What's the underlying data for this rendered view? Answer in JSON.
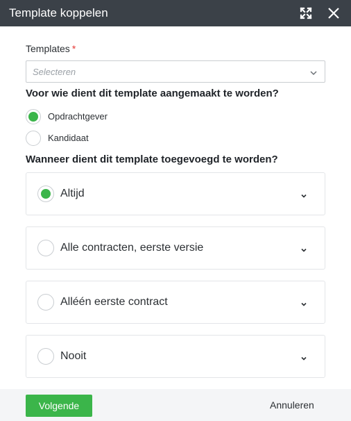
{
  "dialog": {
    "title": "Template koppelen"
  },
  "templates_field": {
    "label": "Templates",
    "required_marker": "*",
    "placeholder": "Selecteren"
  },
  "question_1": {
    "text": "Voor wie dient dit template aangemaakt te worden?",
    "options": [
      {
        "label": "Opdrachtgever",
        "selected": true
      },
      {
        "label": "Kandidaat",
        "selected": false
      }
    ]
  },
  "question_2": {
    "text": "Wanneer dient dit template toegevoegd te worden?",
    "options": [
      {
        "label": "Altijd",
        "selected": true
      },
      {
        "label": "Alle contracten, eerste versie",
        "selected": false
      },
      {
        "label": "Alléén eerste contract",
        "selected": false
      },
      {
        "label": "Nooit",
        "selected": false
      }
    ]
  },
  "footer": {
    "next_label": "Volgende",
    "cancel_label": "Annuleren"
  },
  "colors": {
    "titlebar": "#3b4148",
    "accent": "#3bb54a",
    "required": "#e53935"
  },
  "icons": {
    "expand": "expand-icon",
    "close": "close-icon",
    "chevron": "chevron-down-icon"
  }
}
